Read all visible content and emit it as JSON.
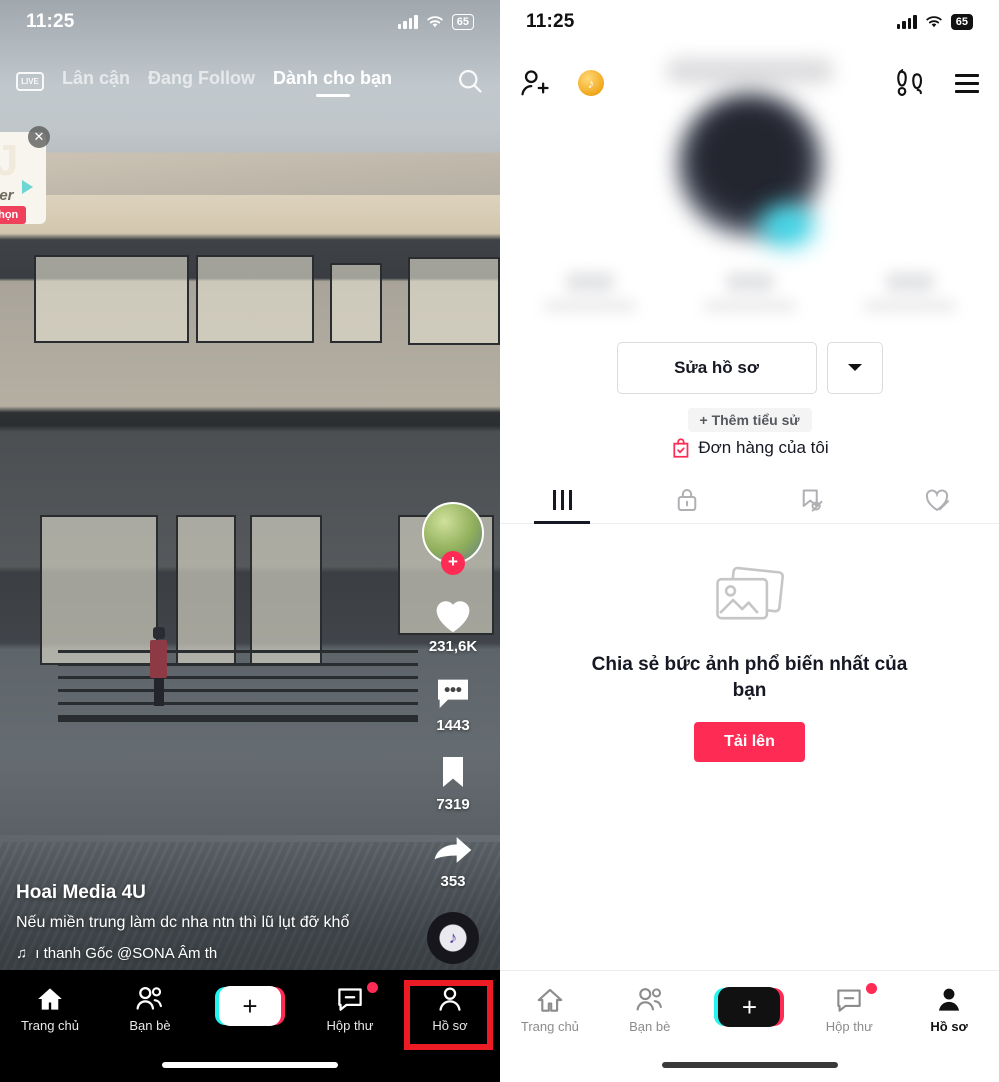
{
  "left": {
    "status": {
      "time": "11:25",
      "battery": "65",
      "signal_icon": "cellular-signal-icon",
      "wifi_icon": "wifi-icon"
    },
    "topnav": {
      "live_label": "LIVE",
      "tabs": [
        {
          "label": "Lân cận",
          "active": false
        },
        {
          "label": "Đang Follow",
          "active": false
        },
        {
          "label": "Dành cho bạn",
          "active": true
        }
      ],
      "search_icon": "search-icon"
    },
    "ad": {
      "text": "ster",
      "cta": "chọn",
      "close_icon": "close-icon"
    },
    "rail": {
      "avatar_plus": "+",
      "items": [
        {
          "icon": "heart-icon",
          "count": "231,6K"
        },
        {
          "icon": "comment-icon",
          "count": "1443"
        },
        {
          "icon": "bookmark-icon",
          "count": "7319"
        },
        {
          "icon": "share-icon",
          "count": "353"
        }
      ],
      "disc_icon": "music-disc-icon"
    },
    "caption": {
      "username": "Hoai Media 4U",
      "description": "Nếu miền trung làm dc nha ntn thì lũ lụt đỡ khổ",
      "music_icon": "music-note-icon",
      "music": "ı thanh Gốc    @SONA Âm th"
    },
    "tabbar": [
      {
        "label": "Trang chủ",
        "icon": "home-icon",
        "active": true,
        "badge": false
      },
      {
        "label": "Bạn bè",
        "icon": "friends-icon",
        "active": false,
        "badge": false
      },
      {
        "label": "",
        "icon": "create-icon",
        "active": false,
        "badge": false
      },
      {
        "label": "Hộp thư",
        "icon": "inbox-icon",
        "active": false,
        "badge": true
      },
      {
        "label": "Hồ sơ",
        "icon": "profile-icon",
        "active": false,
        "badge": false
      }
    ]
  },
  "right": {
    "status": {
      "time": "11:25",
      "battery": "65",
      "signal_icon": "cellular-signal-icon",
      "wifi_icon": "wifi-icon"
    },
    "header": {
      "add_friend_icon": "add-person-icon",
      "coin_icon": "tiktok-coin-icon",
      "footprint_icon": "footprint-icon",
      "menu_icon": "hamburger-menu-icon"
    },
    "profile": {
      "edit_label": "Sửa hồ sơ",
      "caret_icon": "chevron-down-icon",
      "add_bio_label": "+ Thêm tiểu sử",
      "orders_label": "Đơn hàng của tôi",
      "orders_icon": "shopping-bag-icon"
    },
    "tabs": [
      {
        "icon": "grid-icon",
        "active": true
      },
      {
        "icon": "lock-icon",
        "active": false
      },
      {
        "icon": "repost-off-icon",
        "active": false
      },
      {
        "icon": "liked-off-icon",
        "active": false
      }
    ],
    "empty": {
      "image_icon": "photo-stack-icon",
      "text": "Chia sẻ bức ảnh phổ biến nhất của bạn",
      "upload_label": "Tải lên"
    },
    "tabbar": [
      {
        "label": "Trang chủ",
        "icon": "home-icon",
        "active": false,
        "badge": false
      },
      {
        "label": "Bạn bè",
        "icon": "friends-icon",
        "active": false,
        "badge": false
      },
      {
        "label": "",
        "icon": "create-icon",
        "active": false,
        "badge": false
      },
      {
        "label": "Hộp thư",
        "icon": "inbox-icon",
        "active": false,
        "badge": true
      },
      {
        "label": "Hồ sơ",
        "icon": "profile-icon",
        "active": true,
        "badge": false
      }
    ]
  },
  "annotations": {
    "highlight_color": "#ed1c24"
  }
}
